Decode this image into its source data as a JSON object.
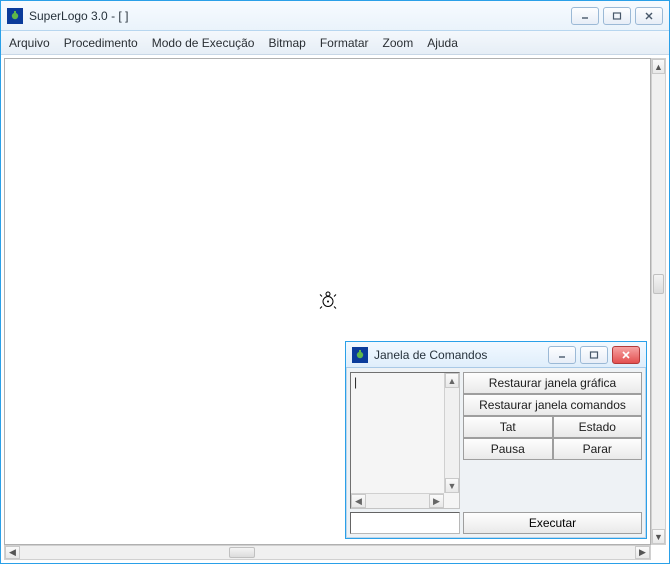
{
  "main_window": {
    "title": "SuperLogo 3.0 - [ ]",
    "menu": [
      "Arquivo",
      "Procedimento",
      "Modo de Execução",
      "Bitmap",
      "Formatar",
      "Zoom",
      "Ajuda"
    ]
  },
  "commands_window": {
    "title": "Janela de Comandos",
    "history_text": "|",
    "command_input": "",
    "buttons": {
      "restore_graphics": "Restaurar janela gráfica",
      "restore_commands": "Restaurar janela comandos",
      "tat": "Tat",
      "estado": "Estado",
      "pausa": "Pausa",
      "parar": "Parar",
      "execute": "Executar"
    }
  }
}
